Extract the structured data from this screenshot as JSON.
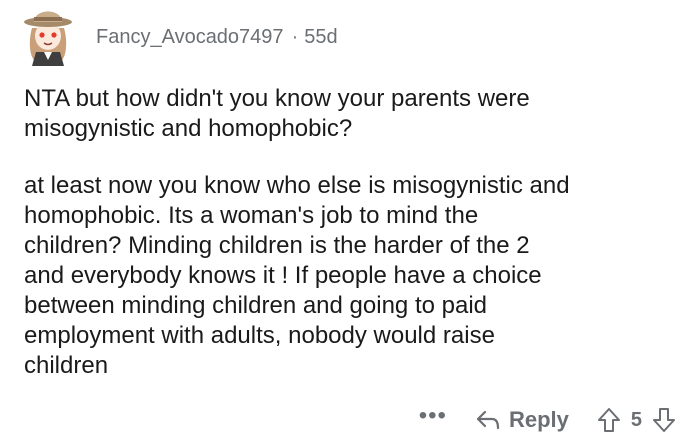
{
  "comment": {
    "username": "Fancy_Avocado7497",
    "separator": "·",
    "age": "55d",
    "paragraphs": [
      "NTA but how didn't you know your parents were\nmisogynistic and homophobic?",
      "at least now you know who else is misogynistic and\nhomophobic.  Its a woman's job to mind the\nchildren?  Minding children is the harder of the 2\nand everybody knows it !  If people have a choice\nbetween minding children and going to paid\nemployment with adults, nobody would raise\nchildren"
    ],
    "actions": {
      "more": "•••",
      "reply_label": "Reply",
      "vote_count": "5"
    }
  }
}
